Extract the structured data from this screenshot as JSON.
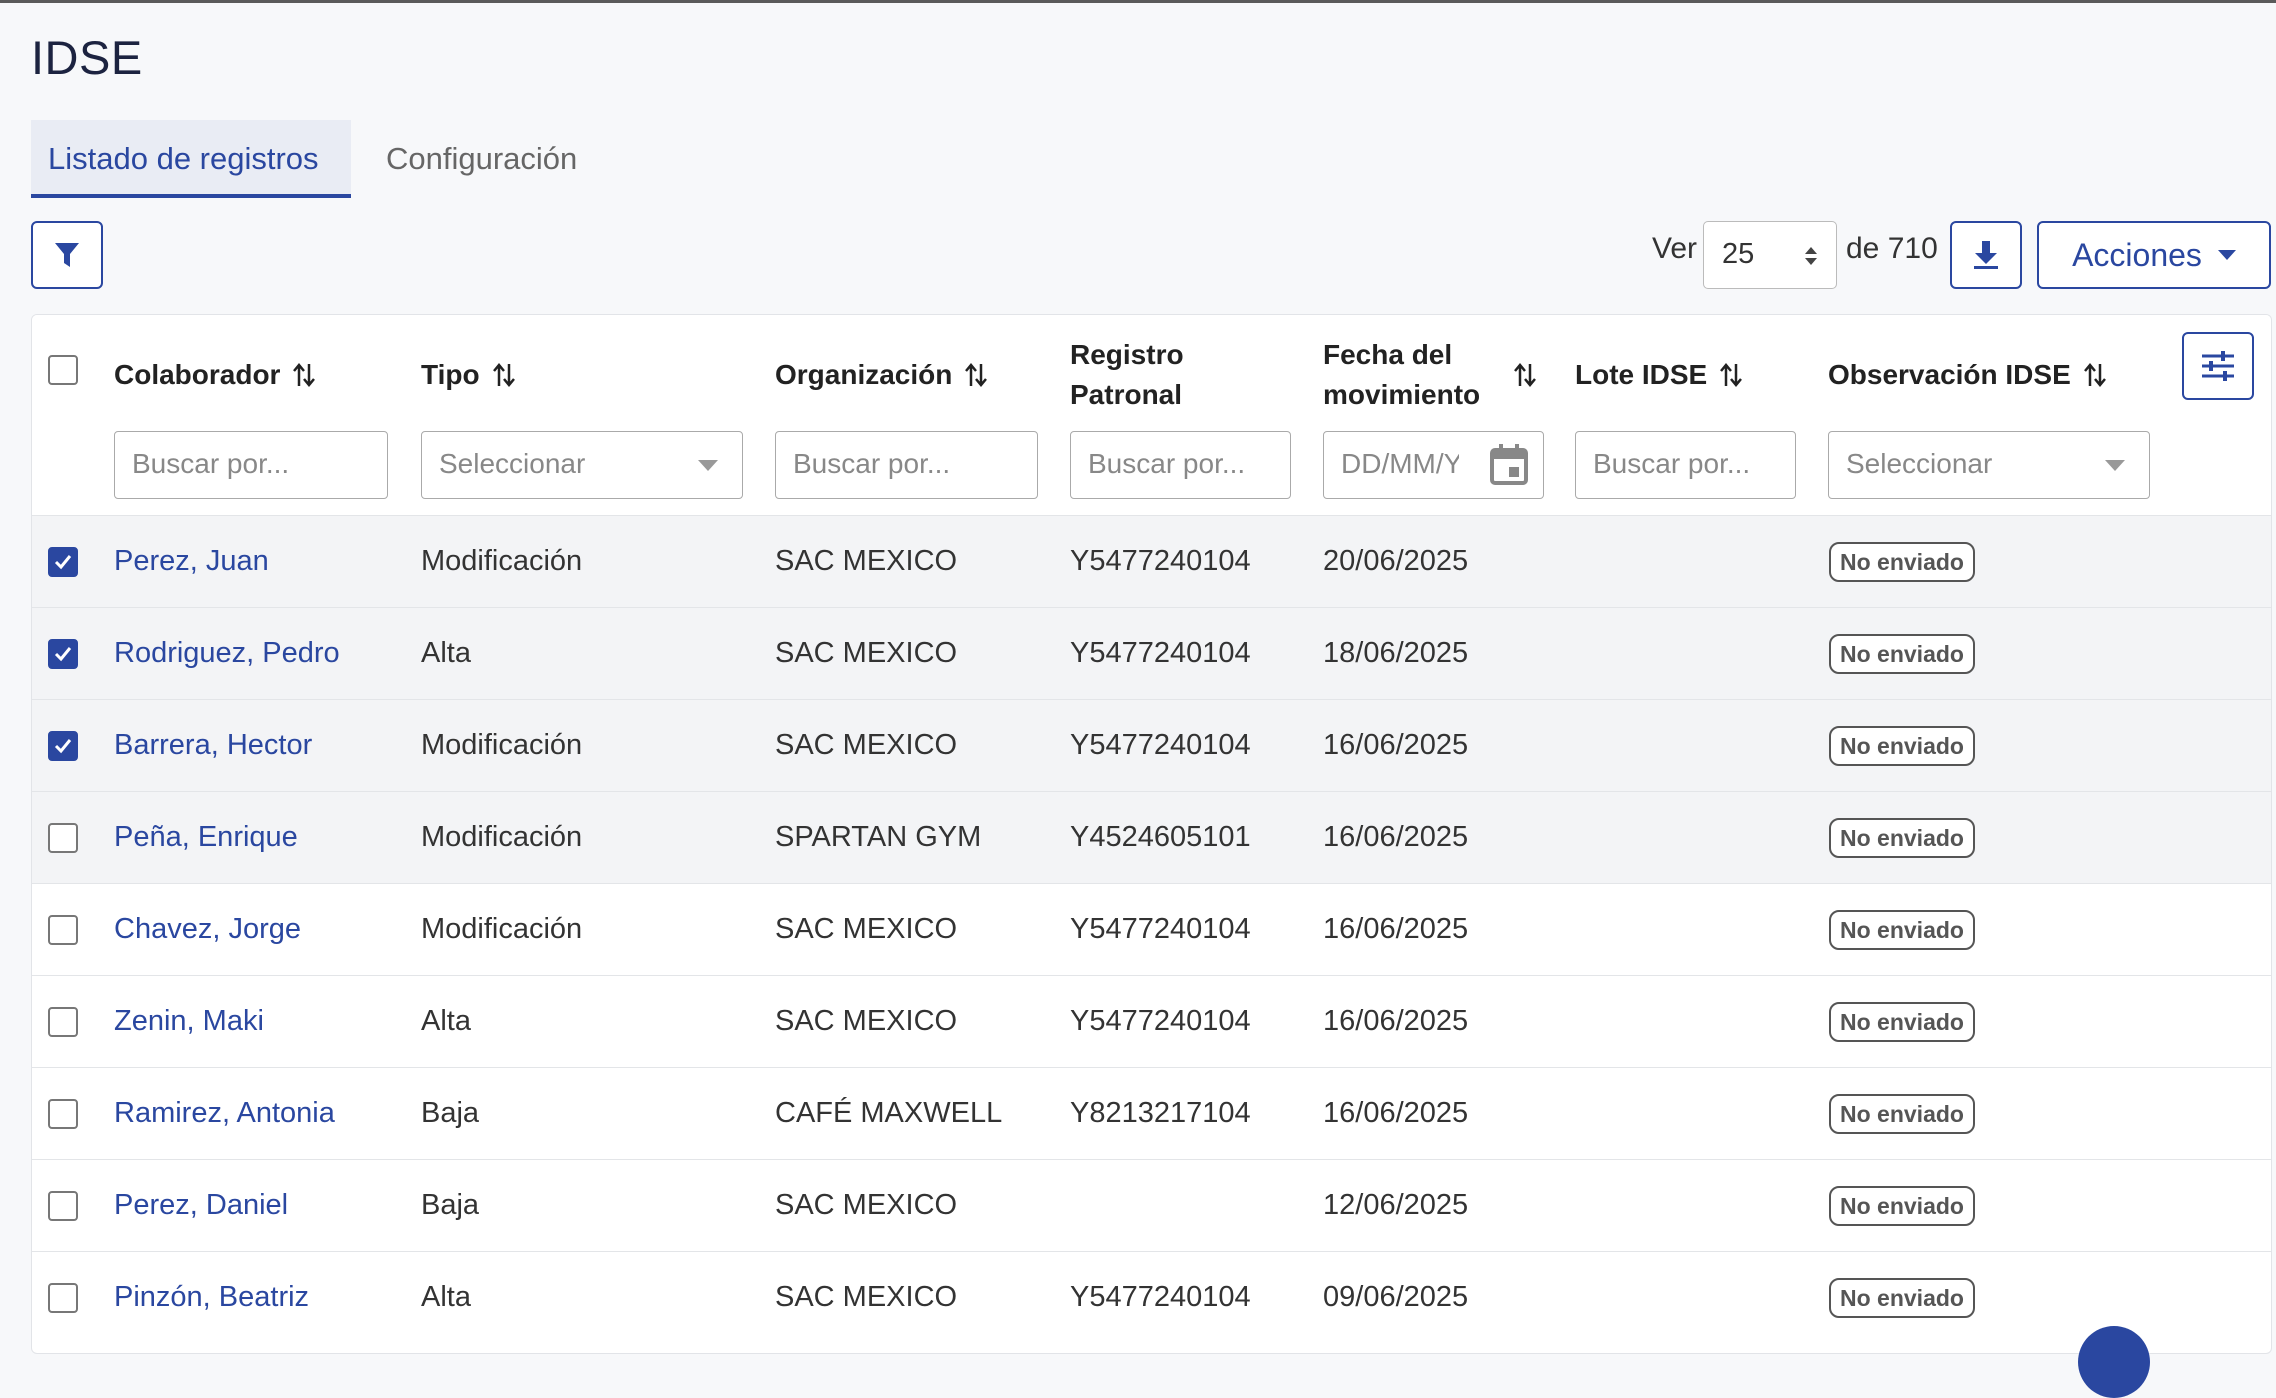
{
  "page": {
    "title": "IDSE"
  },
  "tabs": [
    {
      "label": "Listado de registros",
      "active": true
    },
    {
      "label": "Configuración",
      "active": false
    }
  ],
  "toolbar": {
    "filter_icon": "filter-icon",
    "ver_label": "Ver",
    "page_size": "25",
    "of_label": "de 710",
    "download_icon": "download-icon",
    "acciones_label": "Acciones"
  },
  "table": {
    "columns": [
      {
        "label": "Colaborador",
        "sortable": true
      },
      {
        "label": "Tipo",
        "sortable": true
      },
      {
        "label": "Organización",
        "sortable": true
      },
      {
        "label": "Registro Patronal",
        "sortable": false
      },
      {
        "label": "Fecha del movimiento",
        "sortable": true
      },
      {
        "label": "Lote IDSE",
        "sortable": true
      },
      {
        "label": "Observación IDSE",
        "sortable": true
      }
    ],
    "filters": {
      "colaborador": "Buscar por...",
      "tipo": "Seleccionar",
      "organizacion": "Buscar por...",
      "registro": "Buscar por...",
      "fecha": "DD/MM/YYYY",
      "lote": "Buscar por...",
      "observacion": "Seleccionar"
    },
    "rows": [
      {
        "checked": true,
        "colaborador": "Perez, Juan",
        "tipo": "Modificación",
        "organizacion": "SAC MEXICO",
        "registro": "Y5477240104",
        "fecha": "20/06/2025",
        "lote": "",
        "observacion": "No enviado"
      },
      {
        "checked": true,
        "colaborador": "Rodriguez, Pedro",
        "tipo": "Alta",
        "organizacion": "SAC MEXICO",
        "registro": "Y5477240104",
        "fecha": "18/06/2025",
        "lote": "",
        "observacion": "No enviado"
      },
      {
        "checked": true,
        "colaborador": "Barrera, Hector",
        "tipo": "Modificación",
        "organizacion": "SAC MEXICO",
        "registro": "Y5477240104",
        "fecha": "16/06/2025",
        "lote": "",
        "observacion": "No enviado"
      },
      {
        "checked": false,
        "colaborador": "Peña, Enrique",
        "tipo": "Modificación",
        "organizacion": "SPARTAN GYM",
        "registro": "Y4524605101",
        "fecha": "16/06/2025",
        "lote": "",
        "observacion": "No enviado"
      },
      {
        "checked": false,
        "colaborador": "Chavez, Jorge",
        "tipo": "Modificación",
        "organizacion": "SAC MEXICO",
        "registro": "Y5477240104",
        "fecha": "16/06/2025",
        "lote": "",
        "observacion": "No enviado"
      },
      {
        "checked": false,
        "colaborador": "Zenin, Maki",
        "tipo": "Alta",
        "organizacion": "SAC MEXICO",
        "registro": "Y5477240104",
        "fecha": "16/06/2025",
        "lote": "",
        "observacion": "No enviado"
      },
      {
        "checked": false,
        "colaborador": "Ramirez, Antonia",
        "tipo": "Baja",
        "organizacion": "CAFÉ MAXWELL",
        "registro": "Y8213217104",
        "fecha": "16/06/2025",
        "lote": "",
        "observacion": "No enviado"
      },
      {
        "checked": false,
        "colaborador": "Perez, Daniel",
        "tipo": "Baja",
        "organizacion": "SAC MEXICO",
        "registro": "",
        "fecha": "12/06/2025",
        "lote": "",
        "observacion": "No enviado"
      },
      {
        "checked": false,
        "colaborador": "Pinzón, Beatriz",
        "tipo": "Alta",
        "organizacion": "SAC MEXICO",
        "registro": "Y5477240104",
        "fecha": "09/06/2025",
        "lote": "",
        "observacion": "No enviado"
      }
    ]
  },
  "theme": {
    "accent": "#2a47a0",
    "title_color": "#1c2340"
  }
}
